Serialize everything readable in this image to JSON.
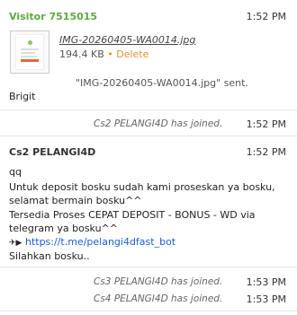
{
  "visitor": {
    "name": "Visitor 7515015",
    "time": "1:52 PM",
    "file": {
      "filename": "IMG-20260405-WA0014.jpg",
      "size": "194.4 KB",
      "bullet": "•",
      "delete_label": "Delete"
    },
    "sent_text": "\"IMG-20260405-WA0014.jpg\" sent.",
    "follow_text": "Brigit"
  },
  "system1": {
    "text": "Cs2 PELANGI4D has joined.",
    "time": "1:52 PM"
  },
  "agent": {
    "name": "Cs2 PELANGI4D",
    "time": "1:52 PM",
    "lines": [
      "qq",
      "Untuk deposit bosku sudah kami proseskan ya bosku,",
      "selamat bermain bosku^^",
      "Tersedia Proses CEPAT DEPOSIT - BONUS - WD via",
      "telegram ya bosku^^",
      "Silahkan bosku.."
    ],
    "link_prefix": "✈▶",
    "link": "https://t.me/pelangi4dfast_bot"
  },
  "system2": {
    "text": "Cs3 PELANGI4D has joined.",
    "time": "1:53 PM"
  },
  "system3": {
    "text": "Cs4 PELANGI4D has joined.",
    "time": "1:53 PM"
  },
  "colors": {
    "visitor_name": "#5fa843",
    "link": "#1a5fd1",
    "delete": "#e8903a"
  }
}
